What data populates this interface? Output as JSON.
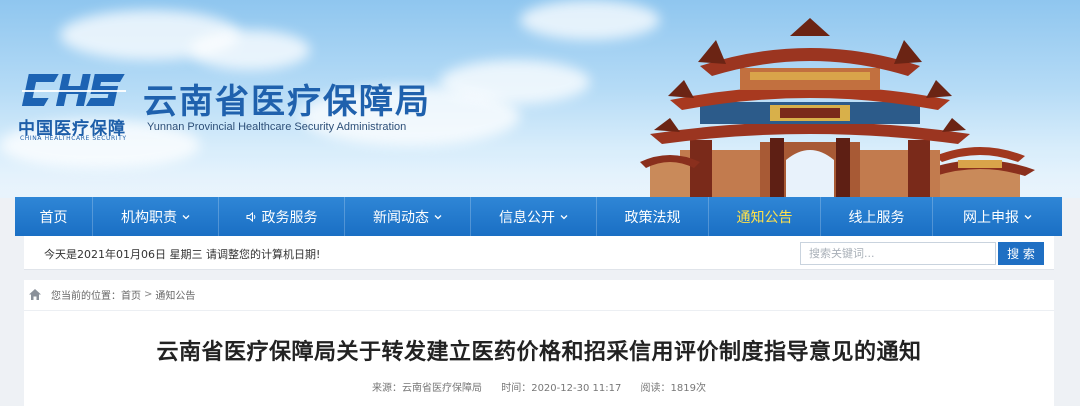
{
  "header": {
    "logo_mark": "CHS",
    "logo_cn": "中国医疗保障",
    "logo_en": "CHINA HEALTHCARE SECURITY",
    "site_title": "云南省医疗保障局",
    "site_subtitle": "Yunnan Provincial Healthcare Security Administration",
    "brand_color": "#1f61ad"
  },
  "nav": {
    "items": [
      {
        "label": "首页",
        "dropdown": false,
        "icon": null,
        "active": false
      },
      {
        "label": "机构职责",
        "dropdown": true,
        "icon": null,
        "active": false
      },
      {
        "label": "政务服务",
        "dropdown": false,
        "icon": "speaker-icon",
        "active": false
      },
      {
        "label": "新闻动态",
        "dropdown": true,
        "icon": null,
        "active": false
      },
      {
        "label": "信息公开",
        "dropdown": true,
        "icon": null,
        "active": false
      },
      {
        "label": "政策法规",
        "dropdown": false,
        "icon": null,
        "active": false
      },
      {
        "label": "通知公告",
        "dropdown": false,
        "icon": null,
        "active": true
      },
      {
        "label": "线上服务",
        "dropdown": false,
        "icon": null,
        "active": false
      },
      {
        "label": "网上申报",
        "dropdown": true,
        "icon": null,
        "active": false
      }
    ],
    "background": "#1f72c6",
    "active_color": "#ffe14a"
  },
  "infobar": {
    "date_text": "今天是2021年01月06日 星期三 请调整您的计算机日期!",
    "search_placeholder": "搜索关键词...",
    "search_button": "搜 索"
  },
  "breadcrumb": {
    "prefix": "您当前的位置：",
    "items": [
      "首页",
      "通知公告"
    ],
    "separator": ">"
  },
  "article": {
    "title": "云南省医疗保障局关于转发建立医药价格和招采信用评价制度指导意见的通知",
    "source": "来源：云南省医疗保障局",
    "time": "时间：2020-12-30 11:17",
    "views": "阅读：1819次"
  }
}
